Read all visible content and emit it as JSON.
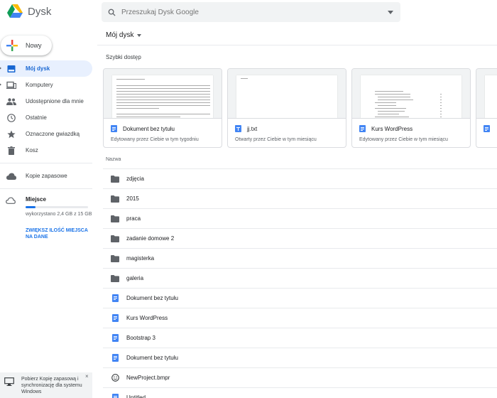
{
  "app": {
    "title": "Dysk"
  },
  "search": {
    "placeholder": "Przeszukaj Dysk Google"
  },
  "new_button": {
    "label": "Nowy"
  },
  "sidebar": {
    "items": [
      {
        "label": "Mój dysk",
        "icon": "my-drive-icon",
        "active": true
      },
      {
        "label": "Komputery",
        "icon": "computers-icon"
      },
      {
        "label": "Udostępnione dla mnie",
        "icon": "shared-icon"
      },
      {
        "label": "Ostatnie",
        "icon": "clock-icon"
      },
      {
        "label": "Oznaczone gwiazdką",
        "icon": "star-icon"
      },
      {
        "label": "Kosz",
        "icon": "trash-icon"
      },
      {
        "label": "Kopie zapasowe",
        "icon": "cloud-icon"
      }
    ],
    "storage": {
      "label": "Miejsce",
      "used_text": "wykorzystano 2,4 GB z 15 GB",
      "used_fraction": 0.16,
      "upgrade": "ZWIĘKSZ ILOŚĆ MIEJSCA NA DANE"
    }
  },
  "toast": {
    "text": "Pobierz Kopię zapasową i synchronizację dla systemu Windows",
    "close": "×"
  },
  "main": {
    "title": "Mój dysk",
    "quick_access_label": "Szybki dostęp",
    "quick_access": [
      {
        "name": "Dokument bez tytułu",
        "sub": "Edytowany przez Ciebie w tym tygodniu",
        "type": "doc"
      },
      {
        "name": "jj.txt",
        "sub": "Otwarty przez Ciebie w tym miesiącu",
        "type": "txt"
      },
      {
        "name": "Kurs WordPress",
        "sub": "Edytowany przez Ciebie w tym miesiącu",
        "type": "doc"
      },
      {
        "name": "",
        "sub": "",
        "type": "doc"
      }
    ],
    "name_column": "Nazwa",
    "files": [
      {
        "name": "zdjęcia",
        "type": "folder"
      },
      {
        "name": "2015",
        "type": "folder"
      },
      {
        "name": "praca",
        "type": "folder"
      },
      {
        "name": "zadanie domowe 2",
        "type": "folder"
      },
      {
        "name": "magisterka",
        "type": "folder"
      },
      {
        "name": "galeria",
        "type": "folder"
      },
      {
        "name": "Dokument bez tytułu",
        "type": "doc"
      },
      {
        "name": "Kurs WordPress",
        "type": "doc"
      },
      {
        "name": "Bootstrap 3",
        "type": "doc"
      },
      {
        "name": "Dokument bez tytułu",
        "type": "doc"
      },
      {
        "name": "NewProject.bmpr",
        "type": "smiley"
      },
      {
        "name": "Untitled",
        "type": "doc"
      }
    ]
  },
  "colors": {
    "accent": "#1a73e8",
    "active_bg": "#e8f0fe",
    "doc_blue": "#4285f4",
    "folder": "#5f6368"
  }
}
